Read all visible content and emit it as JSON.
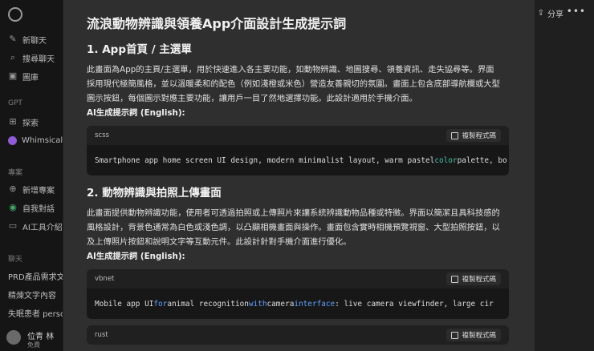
{
  "sidebar": {
    "items": [
      {
        "label": "新聊天",
        "icon": "edit-icon"
      },
      {
        "label": "搜尋聊天",
        "icon": "search-icon"
      },
      {
        "label": "圖庫",
        "icon": "image-icon"
      }
    ],
    "gpt_section": "GPT",
    "gpt_items": [
      {
        "label": "探索",
        "icon": "grid-icon"
      },
      {
        "label": "Whimsical D",
        "icon": "whimsical-icon"
      }
    ],
    "projects_section": "專案",
    "project_items": [
      {
        "label": "新增專案",
        "icon": "folder-plus-icon"
      },
      {
        "label": "自我對話",
        "icon": "chat-icon"
      },
      {
        "label": "AI工具介紹",
        "icon": "folder-icon"
      }
    ],
    "chats_section": "聊天",
    "chat_items": [
      "PRD產品需求文",
      "精煉文字內容",
      "失眠患者 person"
    ],
    "user": {
      "name": "位青 林",
      "plan": "免費"
    }
  },
  "topbar": {
    "share_label": "分享",
    "more_label": "•••"
  },
  "doc": {
    "title": "流浪動物辨識與領養App介面設計生成提示詞",
    "sections": [
      {
        "heading": "1. App首頁 / 主選單",
        "para_lines": [
          "此畫面為App的主頁/主選單，用於快速進入各主要功能，如動物辨識、地圖搜尋、領養資訊、走失協尋等。界面",
          "採用現代極簡風格，並以溫暖柔和的配色（例如淺橙或米色）營造友善親切的氛圍。畫面上包含底部導航欄或大型",
          "圖示按鈕，每個圖示對應主要功能，讓用戶一目了然地選擇功能。此設計適用於手機介面。"
        ],
        "prompt_label": "AI生成提示詞 (English):",
        "code_lang": "scss",
        "code_parts": [
          "Smartphone app home screen UI design, modern minimalist layout, warm pastel ",
          "color",
          " palette, bo"
        ]
      },
      {
        "heading": "2. 動物辨識與拍照上傳畫面",
        "para_lines": [
          "此畫面提供動物辨識功能，使用者可透過拍照或上傳照片來讓系統辨識動物品種或特徵。界面以簡潔且具科技感的",
          "風格設計，背景色通常為白色或淺色調，以凸顯相機畫面與操作。畫面包含實時相機預覽視窗、大型拍照按鈕，以",
          "及上傳照片按鈕和說明文字等互動元件。此設計針對手機介面進行優化。"
        ],
        "prompt_label": "AI生成提示詞 (English):",
        "code_lang": "vbnet",
        "code_parts": [
          "Mobile app UI ",
          "for",
          " animal recognition ",
          "with",
          " camera ",
          "interface",
          ": live camera viewfinder, large cir"
        ]
      }
    ],
    "third_code_lang": "rust",
    "copy_label": "複製程式碼"
  }
}
